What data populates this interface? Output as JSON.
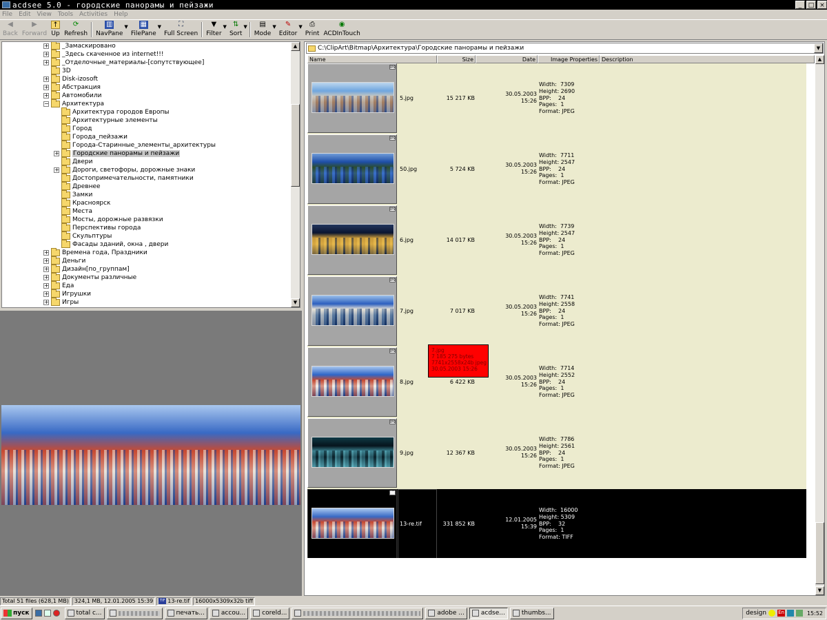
{
  "window": {
    "title": "acdsee 5.0 - городские панорамы и пейзажи"
  },
  "menu": [
    "File",
    "Edit",
    "View",
    "Tools",
    "Activities",
    "Help"
  ],
  "toolbar": {
    "back": "Back",
    "forward": "Forward",
    "up": "Up",
    "refresh": "Refresh",
    "navpane": "NavPane",
    "filepane": "FilePane",
    "fullscreen": "Full Screen",
    "filter": "Filter",
    "sort": "Sort",
    "mode": "Mode",
    "editor": "Editor",
    "print": "Print",
    "acdintouch": "ACDInTouch"
  },
  "tree": [
    {
      "label": "_Замаскировано",
      "level": 1,
      "expandable": true
    },
    {
      "label": "_Здесь скаченное из internet!!!",
      "level": 1,
      "expandable": true
    },
    {
      "label": "_Отделочные_материалы-[сопутствующее]",
      "level": 1,
      "expandable": true
    },
    {
      "label": "3D",
      "level": 1,
      "expandable": false
    },
    {
      "label": "Disk-izosoft",
      "level": 1,
      "expandable": true
    },
    {
      "label": "Абстракция",
      "level": 1,
      "expandable": true
    },
    {
      "label": "Автомобили",
      "level": 1,
      "expandable": true
    },
    {
      "label": "Архитектура",
      "level": 1,
      "expandable": true,
      "expanded": true
    },
    {
      "label": "Архитектура городов Европы",
      "level": 2,
      "expandable": false
    },
    {
      "label": "Архитектурные элементы",
      "level": 2,
      "expandable": false
    },
    {
      "label": "Город",
      "level": 2,
      "expandable": false
    },
    {
      "label": "Города_пейзажи",
      "level": 2,
      "expandable": false
    },
    {
      "label": "Города-Старинные_элементы_архитектуры",
      "level": 2,
      "expandable": false
    },
    {
      "label": "Городские панорамы и пейзажи",
      "level": 2,
      "expandable": true,
      "selected": true
    },
    {
      "label": "Двери",
      "level": 2,
      "expandable": false
    },
    {
      "label": "Дороги, светофоры, дорожные знаки",
      "level": 2,
      "expandable": true
    },
    {
      "label": "Достопримечательности, памятники",
      "level": 2,
      "expandable": false
    },
    {
      "label": "Древнее",
      "level": 2,
      "expandable": false
    },
    {
      "label": "Замки",
      "level": 2,
      "expandable": false
    },
    {
      "label": "Красноярск",
      "level": 2,
      "expandable": false
    },
    {
      "label": "Места",
      "level": 2,
      "expandable": false
    },
    {
      "label": "Мосты, дорожные развязки",
      "level": 2,
      "expandable": false
    },
    {
      "label": "Перспективы города",
      "level": 2,
      "expandable": false
    },
    {
      "label": "Скульптуры",
      "level": 2,
      "expandable": false
    },
    {
      "label": "Фасады зданий, окна , двери",
      "level": 2,
      "expandable": false
    },
    {
      "label": "Времена года, Праздники",
      "level": 1,
      "expandable": true
    },
    {
      "label": "Деньги",
      "level": 1,
      "expandable": true
    },
    {
      "label": "Дизайн[по_группам]",
      "level": 1,
      "expandable": true
    },
    {
      "label": "Документы различные",
      "level": 1,
      "expandable": true
    },
    {
      "label": "Еда",
      "level": 1,
      "expandable": true
    },
    {
      "label": "Игрушки",
      "level": 1,
      "expandable": true
    },
    {
      "label": "Игры",
      "level": 1,
      "expandable": true
    }
  ],
  "filepane": {
    "path": "C:\\ClipArt\\Bitmap\\Архитектура\\Городские панорамы и пейзажи",
    "columns": [
      "Name",
      "Size",
      "Date",
      "Image Properties",
      "Description"
    ],
    "files": [
      {
        "name": "5.jpg",
        "size": "15 217 KB",
        "date": "30.05.2003",
        "time": "15:26",
        "props": "Width:  7309\nHeight: 2690\nBPP:    24\nPages:  1\nFormat: JPEG",
        "badge": "jpg"
      },
      {
        "name": "50.jpg",
        "size": "5 724 KB",
        "date": "30.05.2003",
        "time": "15:26",
        "props": "Width:  7711\nHeight: 2547\nBPP:    24\nPages:  1\nFormat: JPEG",
        "badge": "jpg"
      },
      {
        "name": "6.jpg",
        "size": "14 017 KB",
        "date": "30.05.2003",
        "time": "15:26",
        "props": "Width:  7739\nHeight: 2547\nBPP:    24\nPages:  1\nFormat: JPEG",
        "badge": "jpg"
      },
      {
        "name": "7.jpg",
        "size": "7 017 KB",
        "date": "30.05.2003",
        "time": "15:26",
        "props": "Width:  7741\nHeight: 2558\nBPP:    24\nPages:  1\nFormat: JPEG",
        "badge": "jpg"
      },
      {
        "name": "8.jpg",
        "size": "6 422 KB",
        "date": "30.05.2003",
        "time": "15:26",
        "props": "Width:  7714\nHeight: 2552\nBPP:    24\nPages:  1\nFormat: JPEG",
        "badge": "jpg"
      },
      {
        "name": "9.jpg",
        "size": "12 367 KB",
        "date": "30.05.2003",
        "time": "15:26",
        "props": "Width:  7786\nHeight: 2561\nBPP:    24\nPages:  1\nFormat: JPEG",
        "badge": "jpg"
      },
      {
        "name": "13-re.tif",
        "size": "331 852 KB",
        "date": "12.01.2005",
        "time": "15:39",
        "props": "Width:  16000\nHeight: 5309\nBPP:    32\nPages:  1\nFormat: TIFF",
        "badge": "TIF",
        "selected": true
      }
    ],
    "tooltip": "7.jpg\n7 185 275 bytes\n7741x2558x24b jpeg\n30.05.2003 15:26"
  },
  "status": {
    "total": "Total 51 files (628,1 MB)",
    "selinfo": "324,1 MB, 12.01.2005 15:39",
    "selname": "13-re.tif",
    "seldims": "16000x5309x32b tiff"
  },
  "taskbar": {
    "start": "пуск",
    "tasks": [
      {
        "label": "total c..."
      },
      {
        "label": ""
      },
      {
        "label": "печать..."
      },
      {
        "label": "accou..."
      },
      {
        "label": "coreld..."
      },
      {
        "label": ""
      },
      {
        "label": "adobe ..."
      },
      {
        "label": "acdse...",
        "active": true
      },
      {
        "label": "thumbs..."
      }
    ],
    "tray": {
      "label": "design",
      "lang": "En",
      "clock": "15:52"
    }
  },
  "colors": {
    "rowBg": "#ecebce",
    "selectedRow": "#000000",
    "tooltip": "#ff0000"
  }
}
